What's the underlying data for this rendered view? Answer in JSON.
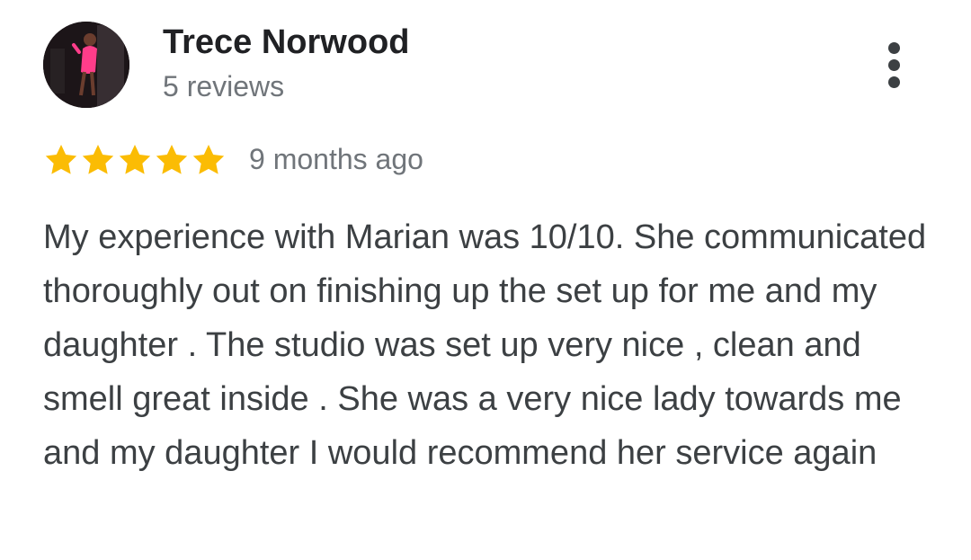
{
  "reviewer": {
    "name": "Trece Norwood",
    "review_count": "5 reviews"
  },
  "review": {
    "rating": 5,
    "max_rating": 5,
    "date": "9 months ago",
    "text": "My experience with Marian was 10/10. She communicated thoroughly out on finishing up the set up for me and my daughter . The studio was set up very nice , clean and smell great inside . She was a very nice lady towards me and my daughter I would recommend her service again"
  },
  "icons": {
    "more": "more-vert-icon",
    "star": "star-icon"
  },
  "colors": {
    "star": "#fbbc04",
    "name": "#202124",
    "secondary": "#70757a",
    "body": "#3c4043"
  }
}
